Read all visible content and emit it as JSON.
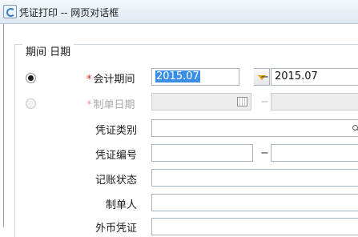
{
  "window": {
    "title": "凭证打印 -- 网页对话框"
  },
  "filter_group": {
    "legend": "期间 日期",
    "period_mode": {
      "label": "会计期间",
      "from": "2015.07",
      "separator": "−",
      "to": "2015.07",
      "selected": true
    },
    "date_mode": {
      "label": "制单日期",
      "from": "",
      "separator": "−",
      "to": "",
      "selected": false,
      "disabled": true
    },
    "required_mark": "*"
  },
  "fields": {
    "voucher_type": {
      "label": "凭证类别",
      "value": ""
    },
    "voucher_number": {
      "label": "凭证编号",
      "from": "",
      "separator": "−",
      "to": ""
    },
    "posting_status": {
      "label": "记账状态",
      "value": ""
    },
    "preparer": {
      "label": "制单人",
      "value": ""
    },
    "next_label": {
      "label": "外币凭证"
    }
  },
  "colors": {
    "selection_highlight": "#3a8ee6",
    "required_mark": "#e02020",
    "dropdown_arrow": "#e0a400"
  }
}
